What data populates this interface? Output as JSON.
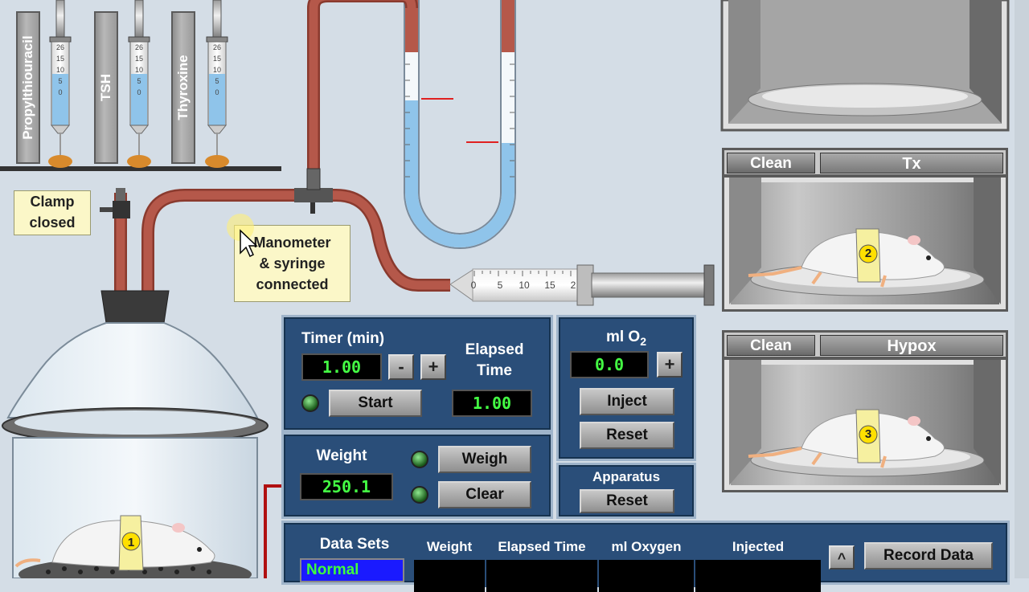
{
  "hormones": [
    "Propylthiouracil",
    "TSH",
    "Thyroxine"
  ],
  "syringe_scale": [
    "26",
    "15",
    "10",
    "5",
    "0"
  ],
  "clamp_tooltip": [
    "Clamp",
    "closed"
  ],
  "manometer_tooltip": [
    "Manometer",
    "& syringe",
    "connected"
  ],
  "main_syringe_scale": [
    "0",
    "5",
    "10",
    "15",
    "2"
  ],
  "timer": {
    "label": "Timer (min)",
    "value": "1.00",
    "minus": "-",
    "plus": "+",
    "start_label": "Start",
    "elapsed_label_line1": "Elapsed",
    "elapsed_label_line2": "Time",
    "elapsed_value": "1.00"
  },
  "oxygen": {
    "label": "ml O",
    "subscript": "2",
    "value": "0.0",
    "plus": "+",
    "inject_label": "Inject",
    "reset_label": "Reset"
  },
  "weight": {
    "label": "Weight",
    "value": "250.1",
    "weigh_label": "Weigh",
    "clear_label": "Clear"
  },
  "apparatus": {
    "label": "Apparatus",
    "reset_label": "Reset"
  },
  "chambers": [
    {
      "clean_label": "Clean",
      "name": "Tx",
      "rat_number": "2"
    },
    {
      "clean_label": "Clean",
      "name": "Hypox",
      "rat_number": "3"
    }
  ],
  "main_rat_number": "1",
  "datasets": {
    "title": "Data Sets",
    "selected": "Normal",
    "columns": [
      "Weight",
      "Elapsed Time",
      "ml Oxygen",
      "Injected"
    ],
    "scroll_up": "^",
    "record_label": "Record Data"
  },
  "colors": {
    "panel": "#2a4e79",
    "lcd_text": "#44ff44",
    "tubing": "#a9473a",
    "water": "#8fc4ea",
    "selected_dataset": "#1a1aff"
  }
}
